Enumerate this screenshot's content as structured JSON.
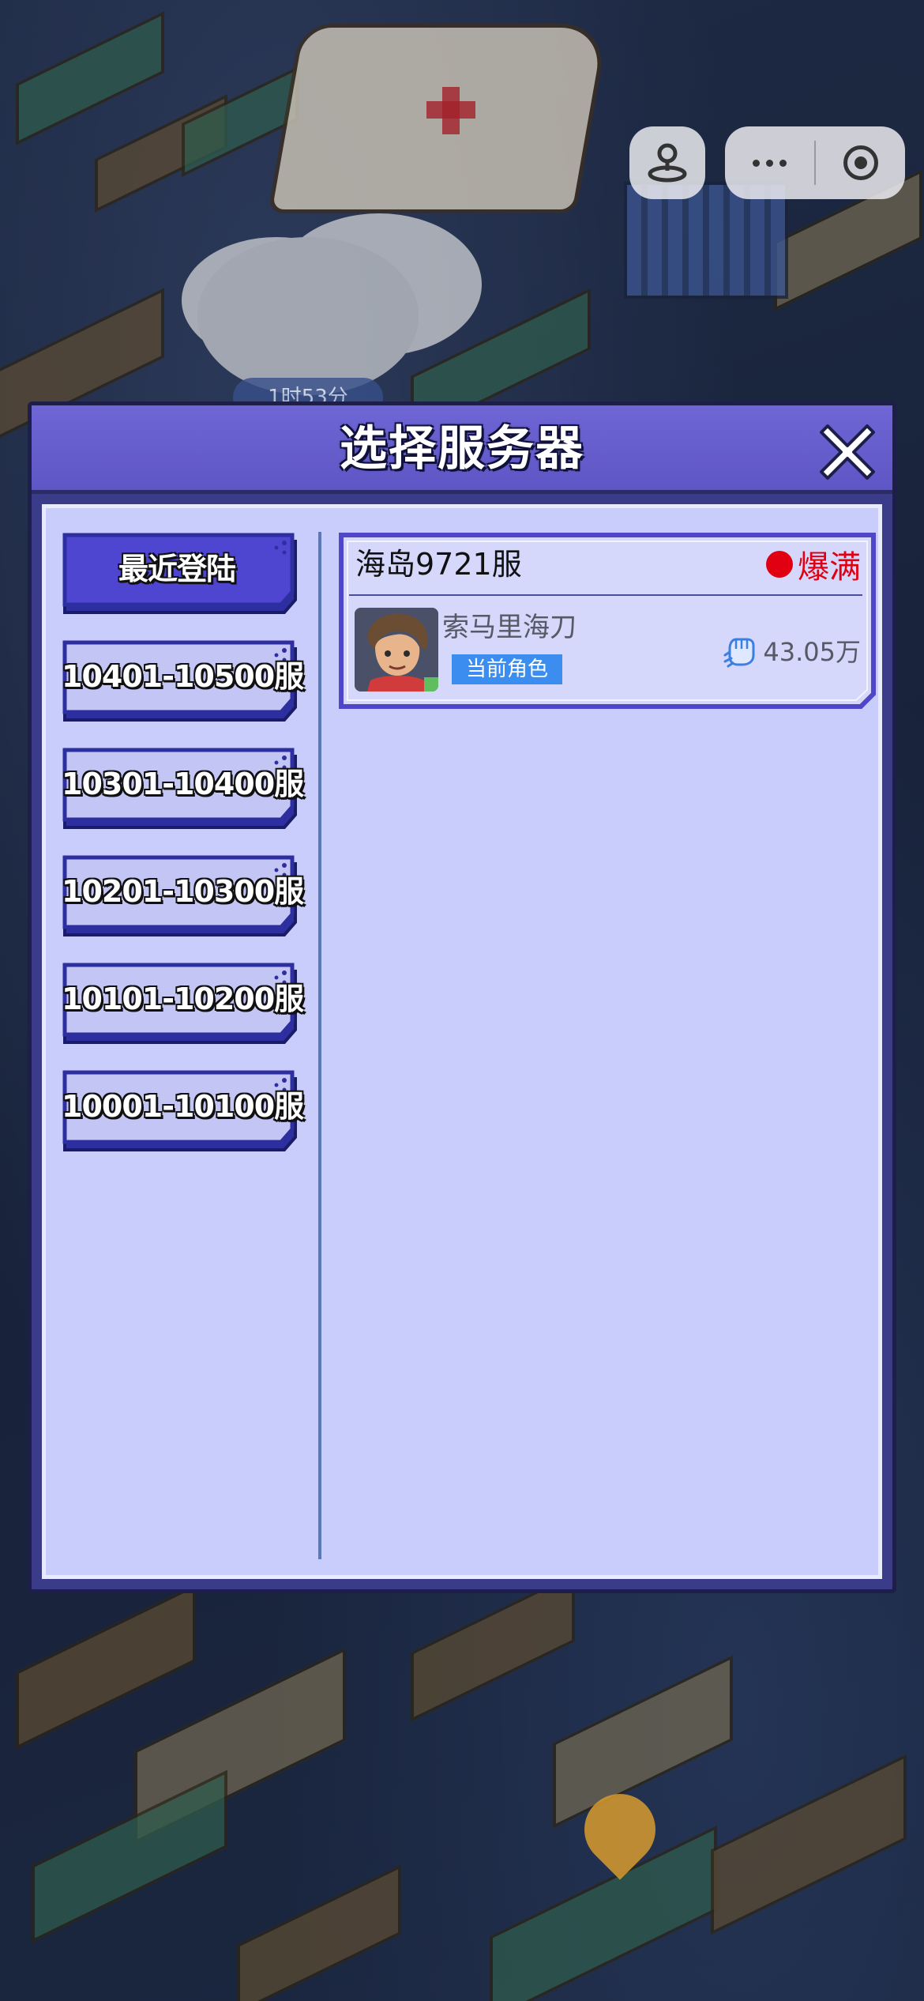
{
  "background": {
    "timer_text": "1时53分"
  },
  "modal": {
    "title": "选择服务器",
    "tabs": [
      {
        "label": "最近登陆",
        "active": true
      },
      {
        "label": "10401-10500服",
        "active": false
      },
      {
        "label": "10301-10400服",
        "active": false
      },
      {
        "label": "10201-10300服",
        "active": false
      },
      {
        "label": "10101-10200服",
        "active": false
      },
      {
        "label": "10001-10100服",
        "active": false
      }
    ],
    "server": {
      "name": "海岛9721服",
      "status": "爆满",
      "status_color": "#e00012",
      "role_name": "索马里海刀",
      "current_label": "当前角色",
      "power": "43.05万",
      "power_icon": "fist-icon"
    }
  },
  "colors": {
    "header": "#6f66d6",
    "body": "#c9cdfb",
    "tab_active": "#4e45d0",
    "tab_inactive": "#c3c6f4",
    "badge": "#3b8eef"
  }
}
